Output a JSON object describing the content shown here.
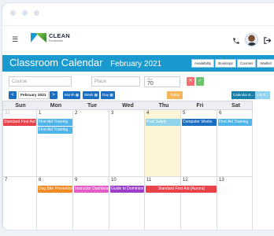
{
  "window_dots": [
    "dot",
    "dot",
    "dot"
  ],
  "topbar": {
    "menu_icon": "hamburger-icon",
    "logo": {
      "name": "CLEAN",
      "sub": "Enrolments"
    },
    "phone_icon": "phone-icon",
    "logout_icon": "logout-icon"
  },
  "header": {
    "title": "Classroom Calendar",
    "month": "February 2021",
    "view_tabs": [
      "Availability",
      "Bookings",
      "Courses",
      "Waitlist"
    ]
  },
  "filters": {
    "course_placeholder": "Course",
    "place_placeholder": "Place",
    "pax_label": "PAX",
    "pax_value": "70",
    "clear_symbol": "✕",
    "apply_symbol": "✓"
  },
  "nav": {
    "prev": "<",
    "month_label": "February 2021",
    "next": ">",
    "views": [
      "Month",
      "Week",
      "Day"
    ],
    "today": "Today",
    "calendar_buttons": [
      "Calendar E...",
      "List E..."
    ]
  },
  "calendar": {
    "days_of_week": [
      "Sun",
      "Mon",
      "Tue",
      "Wed",
      "Thu",
      "Fri",
      "Sat"
    ],
    "weeks": [
      {
        "days": [
          {
            "num": "31",
            "other": true
          },
          {
            "num": "1"
          },
          {
            "num": "2"
          },
          {
            "num": "3"
          },
          {
            "num": "4",
            "today": true
          },
          {
            "num": "5"
          },
          {
            "num": "6"
          }
        ],
        "events": [
          {
            "label": "Standard First Aid",
            "day": 0,
            "span": 1,
            "row": 0,
            "color": "#e8434b"
          },
          {
            "label": "First Aid Training",
            "day": 1,
            "span": 1,
            "row": 0,
            "color": "#4fb5e8"
          },
          {
            "label": "First Aid Training",
            "day": 1,
            "span": 1,
            "row": 1,
            "color": "#4fb5e8"
          },
          {
            "label": "Pool Safety",
            "day": 4,
            "span": 1,
            "row": 0,
            "color": "#8fd3ea"
          },
          {
            "label": "Computer Works",
            "day": 5,
            "span": 1,
            "row": 0,
            "color": "#1a6fc2"
          },
          {
            "label": "First Aid Training",
            "day": 6,
            "span": 1,
            "row": 0,
            "color": "#4fb5e8"
          }
        ]
      },
      {
        "days": [
          {
            "num": "7"
          },
          {
            "num": "8"
          },
          {
            "num": "9"
          },
          {
            "num": "10"
          },
          {
            "num": "11"
          },
          {
            "num": "12"
          },
          {
            "num": "13"
          }
        ],
        "events": [
          {
            "label": "Dog Bite Prevention",
            "day": 1,
            "span": 1,
            "row": 0,
            "color": "#f08a24"
          },
          {
            "label": "Instructor Dashboard",
            "day": 2,
            "span": 1,
            "row": 0,
            "color": "#e45dc6"
          },
          {
            "label": "Guide to Dominion",
            "day": 3,
            "span": 1,
            "row": 0,
            "color": "#9b3fc7"
          },
          {
            "label": "Standard First Aid (Aurora)",
            "day": 4,
            "span": 2,
            "row": 0,
            "color": "#e8434b"
          }
        ]
      }
    ]
  }
}
